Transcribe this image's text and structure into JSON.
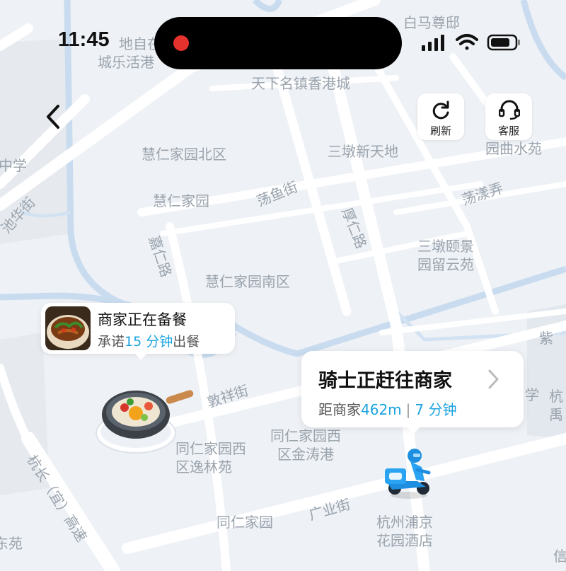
{
  "status_bar": {
    "time": "11:45"
  },
  "nav": {
    "refresh_label": "刷新",
    "support_label": "客服"
  },
  "map": {
    "labels": [
      "白马尊邸",
      "地自在",
      "城乐活港",
      "天下名镇香港城",
      "慧仁家园北区",
      "三墩新天地",
      "三墩",
      "园曲水苑",
      "中学",
      "慧仁家园",
      "荡鱼街",
      "荡漾弄",
      "池华街",
      "厚仁路",
      "三墩颐景",
      "园留云苑",
      "嘉仁路",
      "慧仁家园南区",
      "紫",
      "敦祥街",
      "学",
      "杭",
      "禹",
      "同仁家园西",
      "区金涛港",
      "同仁家园西",
      "区逸林苑",
      "杭长（宜）高速",
      "广业街",
      "同仁家园",
      "杭州浦京",
      "花园酒店",
      "东苑",
      "信"
    ]
  },
  "merchant": {
    "status": "商家正在备餐",
    "promise_prefix": "承诺",
    "promise_value": "15 分钟",
    "promise_suffix": "出餐"
  },
  "rider": {
    "status": "骑士正赶往商家",
    "distance_prefix": "距商家",
    "distance": "462m",
    "separator": "|",
    "eta": "7 分钟"
  },
  "colors": {
    "accent": "#1aa3e0",
    "road": "#ffffff",
    "water": "#c9dcef",
    "background": "#eef1f5"
  }
}
